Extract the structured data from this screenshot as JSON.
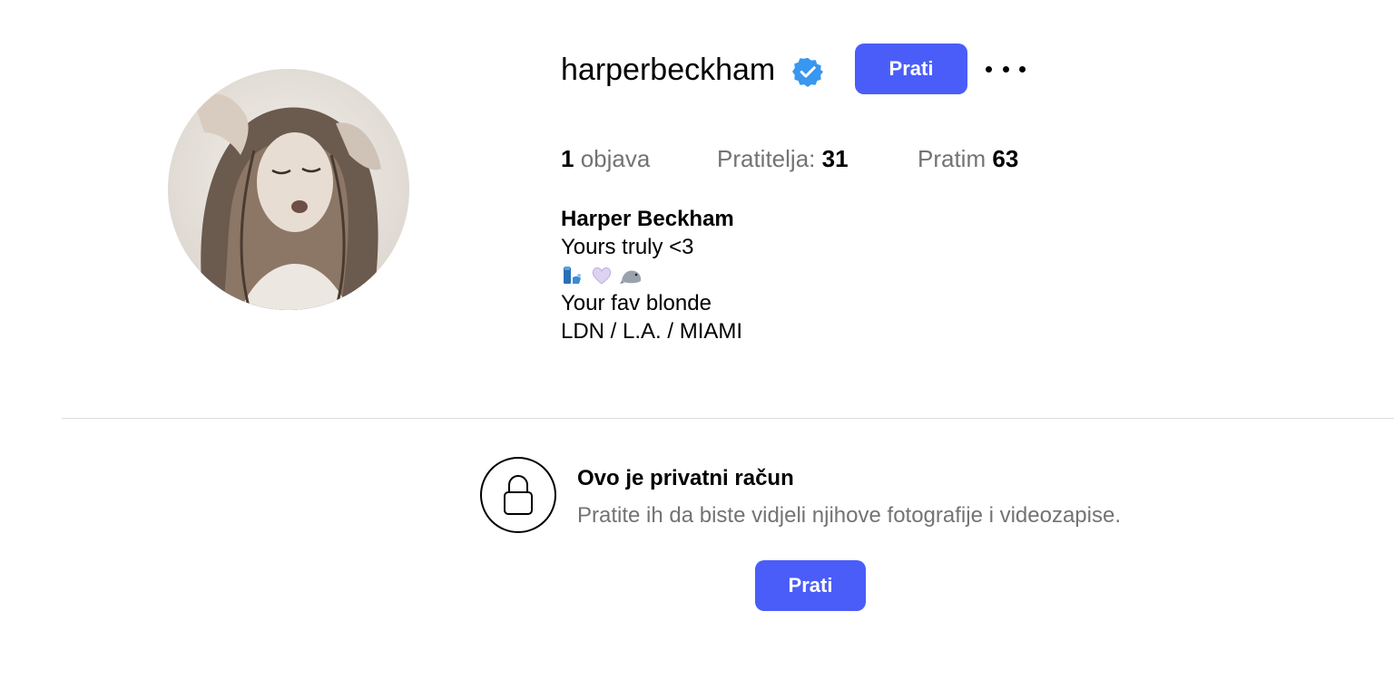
{
  "profile": {
    "username": "harperbeckham",
    "verified": true,
    "follow_label": "Prati",
    "more_icon": "more-options-icon",
    "avatar_alt": "profile-photo"
  },
  "stats": {
    "posts_count": "1",
    "posts_label": "objava",
    "followers_label": "Pratitelja:",
    "followers_count": "31",
    "following_label": "Pratim",
    "following_count": "63"
  },
  "bio": {
    "name": "Harper Beckham",
    "line1": "Yours truly <3",
    "emojis": [
      "blue-figure-emoji",
      "purple-heart-emoji",
      "seal-emoji"
    ],
    "line2": "Your fav blonde",
    "line3": "LDN / L.A. / MIAMI"
  },
  "private_account": {
    "title": "Ovo je privatni račun",
    "subtitle": "Pratite ih da biste vidjeli njihove fotografije i videozapise.",
    "follow_label": "Prati",
    "icon": "lock-icon"
  },
  "colors": {
    "accent": "#4a5df9",
    "verified": "#3897f0",
    "muted_text": "#737373",
    "divider": "#dbdbdb"
  }
}
